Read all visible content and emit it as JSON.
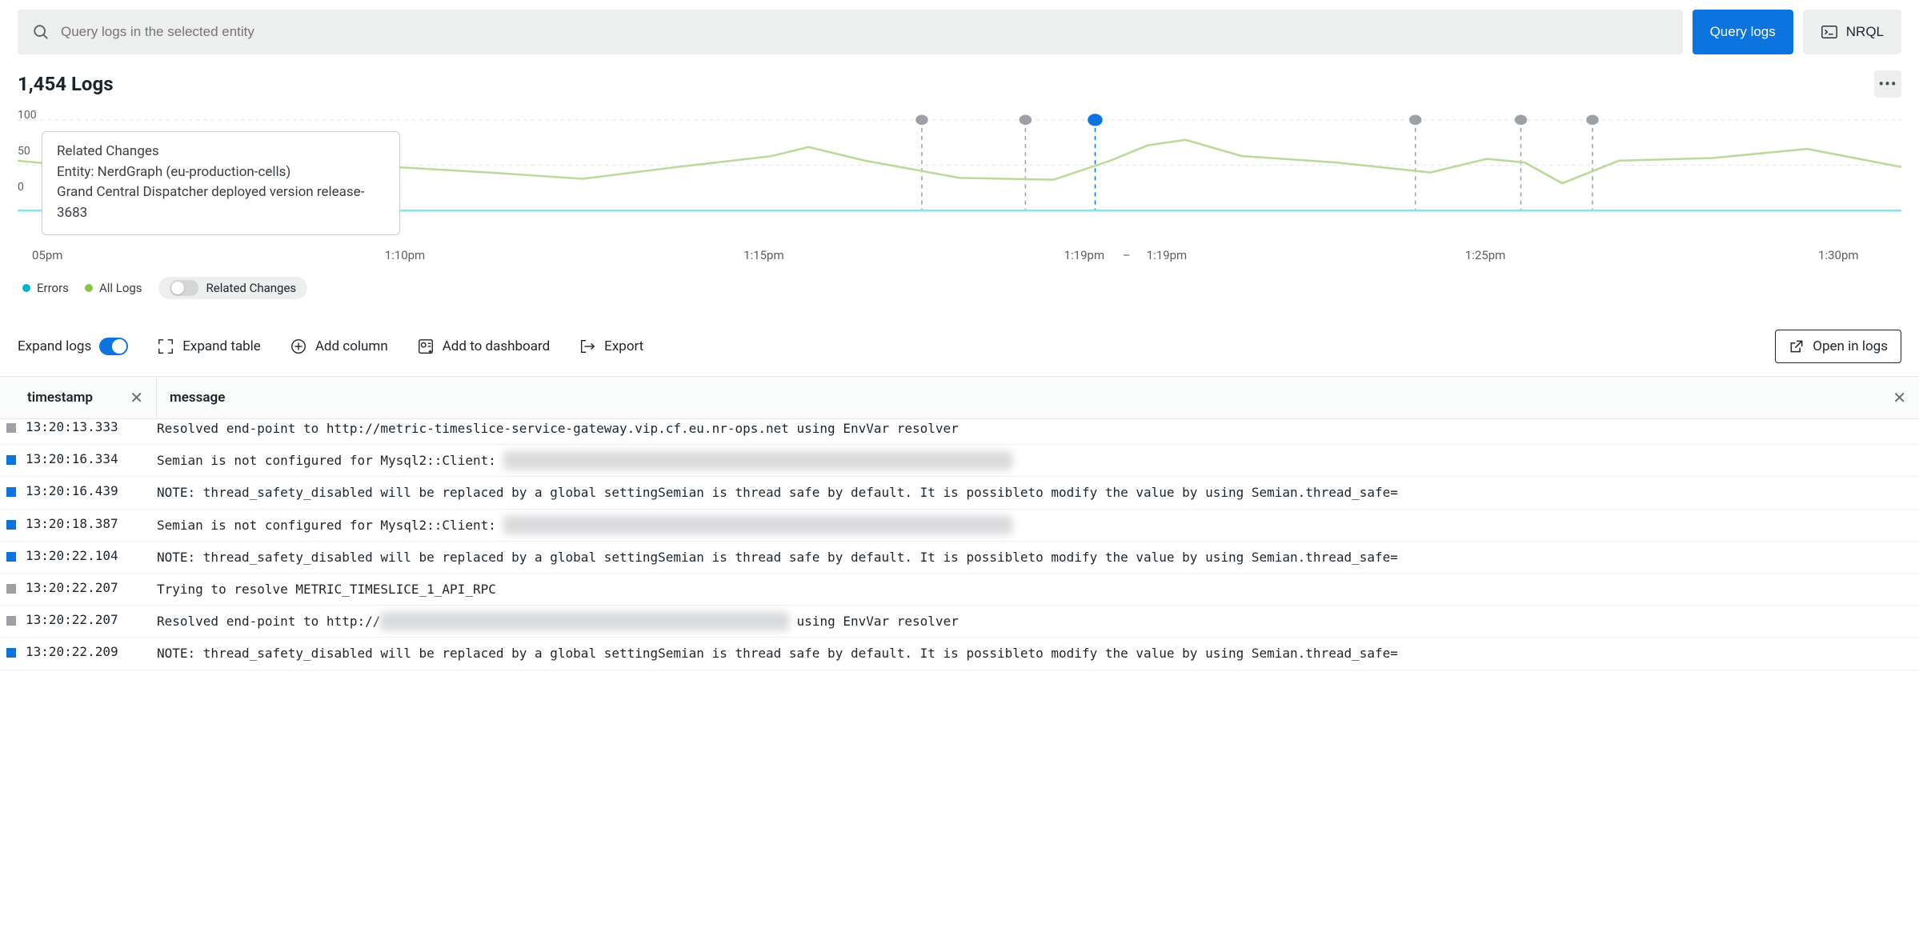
{
  "search": {
    "placeholder": "Query logs in the selected entity"
  },
  "buttons": {
    "query_logs": "Query logs",
    "nrql": "NRQL"
  },
  "title": "1,454 Logs",
  "chart_data": {
    "type": "line",
    "title": "",
    "ylabel": "",
    "ylim": [
      0,
      100
    ],
    "y_ticks": [
      100,
      50,
      0
    ],
    "x_ticks": [
      "05pm",
      "1:10pm",
      "1:15pm",
      "1:19pm",
      "1:19pm",
      "1:25pm",
      "1:30pm"
    ],
    "x_tick_sep": "–",
    "series": [
      {
        "name": "All Logs",
        "color": "#8bc34a",
        "x": [
          0,
          5,
          10,
          15,
          20,
          25,
          30,
          35,
          40,
          42,
          45,
          50,
          55,
          58,
          60,
          62,
          65,
          70,
          75,
          78,
          80,
          82,
          85,
          90,
          95,
          100
        ],
        "y": [
          55,
          45,
          38,
          50,
          48,
          42,
          35,
          48,
          60,
          70,
          55,
          36,
          34,
          55,
          72,
          78,
          60,
          53,
          42,
          57,
          53,
          30,
          55,
          58,
          68,
          48
        ]
      },
      {
        "name": "Errors",
        "color": "#00b3c3",
        "x": [
          0,
          100
        ],
        "y": [
          0,
          0
        ]
      }
    ],
    "markers": [
      {
        "x": 48.0,
        "highlight": false
      },
      {
        "x": 53.5,
        "highlight": false
      },
      {
        "x": 57.2,
        "highlight": true
      },
      {
        "x": 74.2,
        "highlight": false
      },
      {
        "x": 79.8,
        "highlight": false
      },
      {
        "x": 83.6,
        "highlight": false
      }
    ]
  },
  "tooltip": {
    "title": "Related Changes",
    "line1": "Entity: NerdGraph (eu-production-cells)",
    "line2": "Grand Central Dispatcher deployed version release-3683"
  },
  "legend": {
    "errors": "Errors",
    "all_logs": "All Logs",
    "related_changes": "Related Changes",
    "errors_color": "#00b3c3",
    "all_logs_color": "#8bc34a"
  },
  "actions": {
    "expand_logs": "Expand logs",
    "expand_table": "Expand table",
    "add_column": "Add column",
    "add_dashboard": "Add to dashboard",
    "export": "Export",
    "open_in_logs": "Open in logs"
  },
  "columns": {
    "timestamp": "timestamp",
    "message": "message"
  },
  "redacted": "xxxxxxxxxxxxxxxxxxxxxxxxxxxxxxxxxxxxxxxxxxxxxxxxxxxxxxxxxxxxxxxxxx",
  "redacted_short": "xxxxxxxxxxxxxxxxxxxxxxxxxxxxxxxxxxxxxxxxxxxxxxxxxxxxx",
  "logs": [
    {
      "sev": "gray",
      "ts": "13:20:13.333",
      "msg_a": "Resolved end-point to http://metric-timeslice-service-gateway.vip.cf.eu.nr-ops.net using EnvVar resolver",
      "clipped": true
    },
    {
      "sev": "blue",
      "ts": "13:20:16.334",
      "msg_a": "Semian is not configured for Mysql2::Client: ",
      "blur": true
    },
    {
      "sev": "blue",
      "ts": "13:20:16.439",
      "msg_a": "NOTE: thread_safety_disabled will be replaced by a global settingSemian is thread safe by default. It is possibleto modify the value by using Semian.thread_safe="
    },
    {
      "sev": "blue",
      "ts": "13:20:18.387",
      "msg_a": "Semian is not configured for Mysql2::Client: ",
      "blur": true
    },
    {
      "sev": "blue",
      "ts": "13:20:22.104",
      "msg_a": "NOTE: thread_safety_disabled will be replaced by a global settingSemian is thread safe by default. It is possibleto modify the value by using Semian.thread_safe="
    },
    {
      "sev": "gray",
      "ts": "13:20:22.207",
      "msg_a": "Trying to resolve METRIC_TIMESLICE_1_API_RPC"
    },
    {
      "sev": "gray",
      "ts": "13:20:22.207",
      "msg_a": "Resolved end-point to http://",
      "blur": true,
      "msg_b": " using EnvVar resolver"
    },
    {
      "sev": "blue",
      "ts": "13:20:22.209",
      "msg_a": "NOTE: thread_safety_disabled will be replaced by a global settingSemian is thread safe by default. It is possibleto modify the value by using Semian.thread_safe="
    }
  ]
}
